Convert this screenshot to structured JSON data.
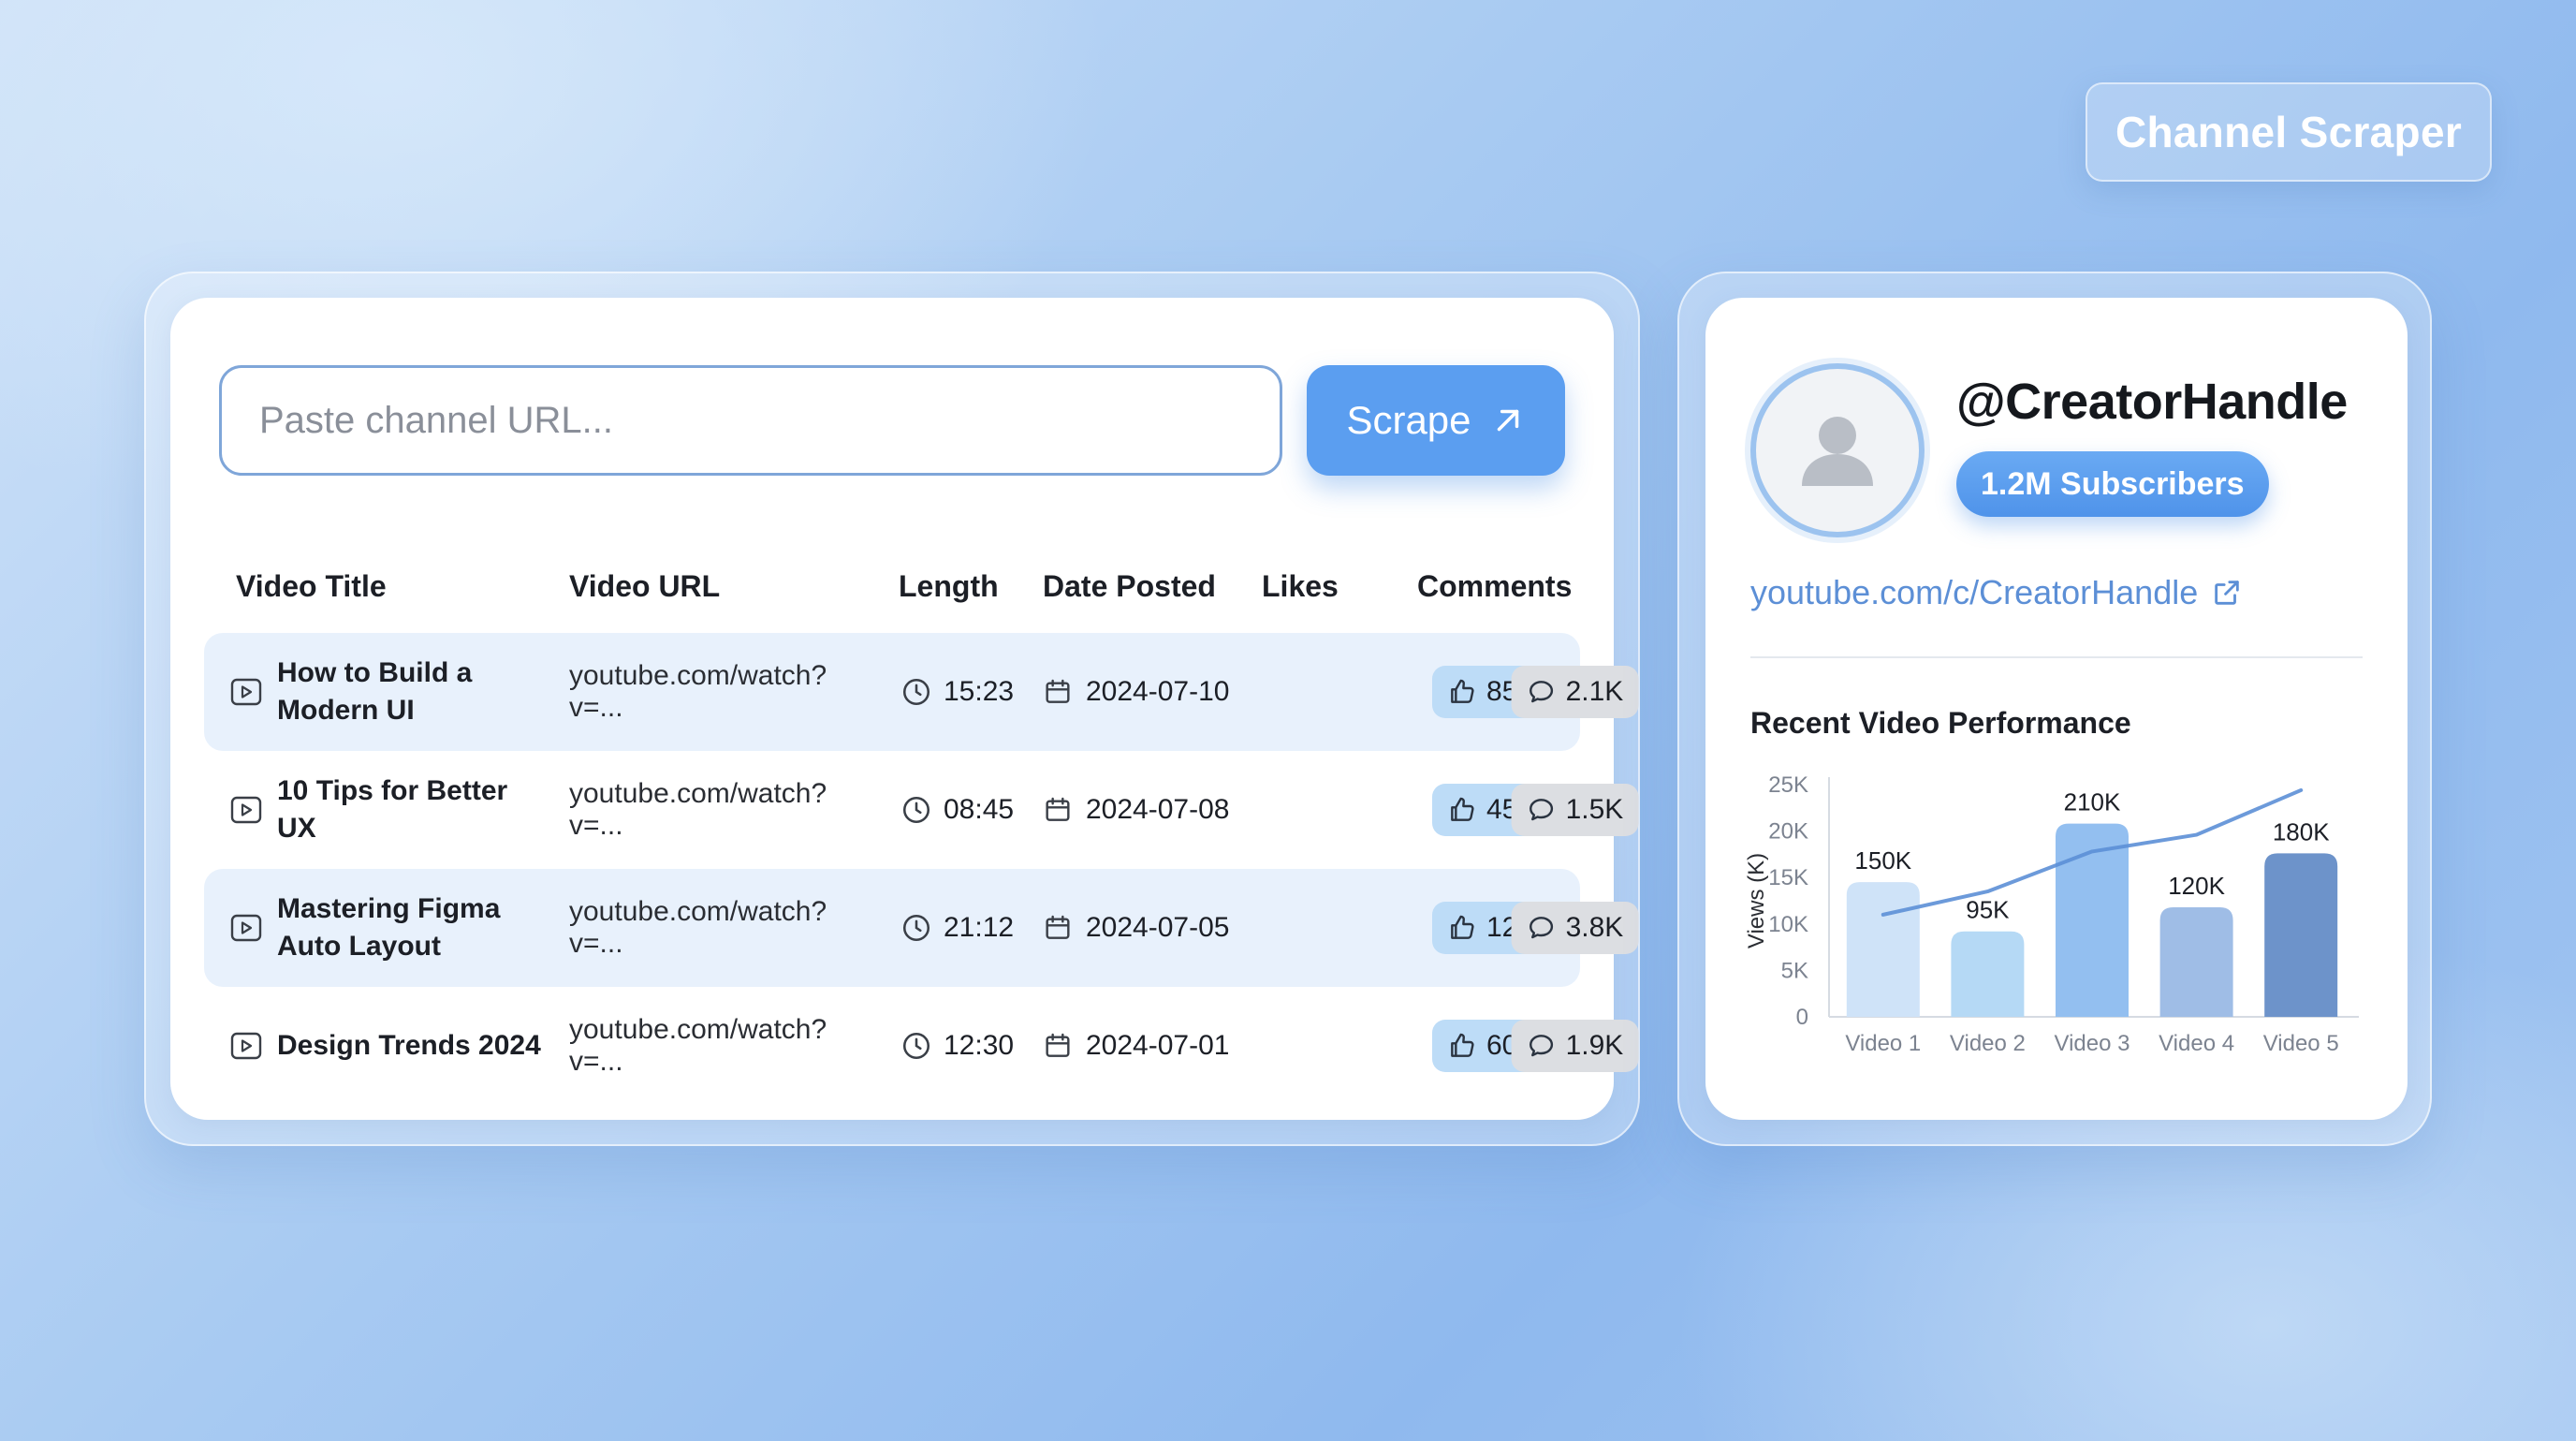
{
  "app_title": "Channel Scraper",
  "search": {
    "placeholder": "Paste channel URL...",
    "button_label": "Scrape"
  },
  "table": {
    "headers": {
      "title": "Video Title",
      "url": "Video URL",
      "length": "Length",
      "date": "Date Posted",
      "likes": "Likes",
      "comments": "Comments"
    },
    "rows": [
      {
        "title": "How to Build a Modern UI",
        "title_l1": "How to Build a",
        "title_l2": "Modern UI",
        "url": "youtube.com/watch?v=...",
        "length": "15:23",
        "date": "2024-07-10",
        "likes": "85K",
        "comments": "2.1K"
      },
      {
        "title": "10 Tips for Better UX",
        "title_l1": "10 Tips for Better UX",
        "title_l2": "",
        "url": "youtube.com/watch?v=...",
        "length": "08:45",
        "date": "2024-07-08",
        "likes": "45K",
        "comments": "1.5K"
      },
      {
        "title": "Mastering Figma Auto Layout",
        "title_l1": "Mastering Figma",
        "title_l2": "Auto Layout",
        "url": "youtube.com/watch?v=...",
        "length": "21:12",
        "date": "2024-07-05",
        "likes": "120K",
        "comments": "3.8K"
      },
      {
        "title": "Design Trends 2024",
        "title_l1": "Design Trends 2024",
        "title_l2": "",
        "url": "youtube.com/watch?v=...",
        "length": "12:30",
        "date": "2024-07-01",
        "likes": "60K",
        "comments": "1.9K"
      }
    ]
  },
  "profile": {
    "handle": "@CreatorHandle",
    "subscribers": "1.2M Subscribers",
    "channel_url": "youtube.com/c/CreatorHandle"
  },
  "performance": {
    "title": "Recent Video Performance"
  },
  "colors": {
    "accent": "#5b9ef0",
    "likes_pill": "#bddcf7",
    "comments_pill": "#dcdee2",
    "alt_row": "#e8f1fc",
    "link": "#5c8fd6"
  },
  "chart_data": {
    "type": "bar",
    "title": "Recent Video Performance",
    "xlabel": "",
    "ylabel": "Views (K)",
    "categories": [
      "Video 1",
      "Video 2",
      "Video 3",
      "Video 4",
      "Video 5"
    ],
    "y_ticks": [
      "0",
      "5K",
      "10K",
      "15K",
      "20K",
      "25K"
    ],
    "ylim": [
      0,
      25
    ],
    "grid": false,
    "series": [
      {
        "values": [
          14.5,
          9.2,
          20.8,
          11.8,
          17.6
        ],
        "labels": [
          "150K",
          "95K",
          "210K",
          "120K",
          "180K"
        ],
        "colors": [
          "#cfe3f8",
          "#b5d9f5",
          "#93bff0",
          "#9fbde6",
          "#6d93ca"
        ]
      }
    ],
    "trend_line": {
      "values": [
        11,
        13.5,
        17.8,
        19.6,
        24.4
      ],
      "color": "#5c8fd6"
    }
  }
}
